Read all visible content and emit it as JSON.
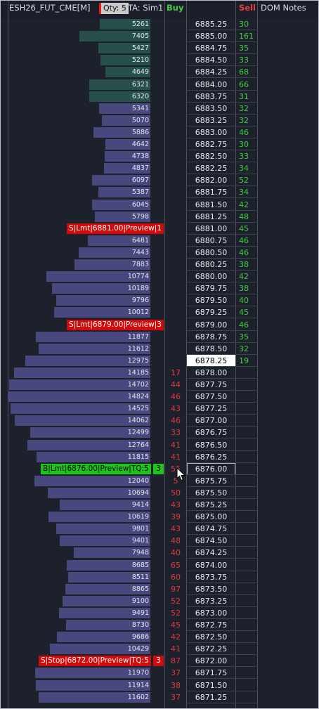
{
  "header": {
    "title": "ESH26_FUT_CME[M]",
    "qty": "Qty: 5",
    "account": "TA: Sim1",
    "buy": "Buy",
    "sell": "Sell",
    "notes": "DOM Notes"
  },
  "colors": {
    "buy_text": "#e03a3a",
    "sell_text": "#3fcf3f",
    "volume_bar": "#48477e",
    "volume_bar_high": "#27504a",
    "order_sell": "#d40a0a",
    "order_buy": "#1cc41c"
  },
  "max_volume": 14824,
  "ladder": [
    {
      "price": "6885.25",
      "volume": "5261",
      "sell": "30",
      "hi": true
    },
    {
      "price": "6885.00",
      "volume": "7405",
      "sell": "161",
      "hi": true
    },
    {
      "price": "6884.75",
      "volume": "5427",
      "sell": "35",
      "hi": true
    },
    {
      "price": "6884.50",
      "volume": "5210",
      "sell": "33",
      "hi": true
    },
    {
      "price": "6884.25",
      "volume": "4649",
      "sell": "68",
      "hi": true
    },
    {
      "price": "6884.00",
      "volume": "6321",
      "sell": "66",
      "hi": true
    },
    {
      "price": "6883.75",
      "volume": "6320",
      "sell": "31",
      "hi": true
    },
    {
      "price": "6883.50",
      "volume": "5341",
      "sell": "32"
    },
    {
      "price": "6883.25",
      "volume": "5070",
      "sell": "32"
    },
    {
      "price": "6883.00",
      "volume": "5886",
      "sell": "46"
    },
    {
      "price": "6882.75",
      "volume": "4642",
      "sell": "30"
    },
    {
      "price": "6882.50",
      "volume": "4738",
      "sell": "33"
    },
    {
      "price": "6882.25",
      "volume": "4837",
      "sell": "34"
    },
    {
      "price": "6882.00",
      "volume": "6097",
      "sell": "52"
    },
    {
      "price": "6881.75",
      "volume": "5387",
      "sell": "34"
    },
    {
      "price": "6881.50",
      "volume": "6045",
      "sell": "42"
    },
    {
      "price": "6881.25",
      "volume": "5798",
      "sell": "48"
    },
    {
      "price": "6881.00",
      "volume": "",
      "sell": "45",
      "order": {
        "label": "S|Lmt|6881.00|Preview|1",
        "color": "red"
      }
    },
    {
      "price": "6880.75",
      "volume": "6481",
      "sell": "46"
    },
    {
      "price": "6880.50",
      "volume": "7443",
      "sell": "46"
    },
    {
      "price": "6880.25",
      "volume": "7883",
      "sell": "38"
    },
    {
      "price": "6880.00",
      "volume": "10774",
      "sell": "42"
    },
    {
      "price": "6879.75",
      "volume": "10189",
      "sell": "38"
    },
    {
      "price": "6879.50",
      "volume": "9796",
      "sell": "40"
    },
    {
      "price": "6879.25",
      "volume": "10012",
      "sell": "45"
    },
    {
      "price": "6879.00",
      "volume": "",
      "sell": "46",
      "order": {
        "label": "S|Lmt|6879.00|Preview|3",
        "color": "red"
      }
    },
    {
      "price": "6878.75",
      "volume": "11877",
      "sell": "35"
    },
    {
      "price": "6878.50",
      "volume": "11612",
      "sell": "32"
    },
    {
      "price": "6878.25",
      "volume": "12975",
      "sell": "19",
      "current": true
    },
    {
      "price": "6878.00",
      "volume": "14185",
      "buy": "17"
    },
    {
      "price": "6877.75",
      "volume": "14702",
      "buy": "44"
    },
    {
      "price": "6877.50",
      "volume": "14824",
      "buy": "46"
    },
    {
      "price": "6877.25",
      "volume": "14525",
      "buy": "43"
    },
    {
      "price": "6877.00",
      "volume": "14062",
      "buy": "46"
    },
    {
      "price": "6876.75",
      "volume": "12499",
      "buy": "33"
    },
    {
      "price": "6876.50",
      "volume": "12764",
      "buy": "41"
    },
    {
      "price": "6876.25",
      "volume": "11815",
      "buy": "41"
    },
    {
      "price": "6876.00",
      "volume": "",
      "buy": "55",
      "selected": true,
      "order": {
        "label": "B|Lmt|6876.00|Preview|TQ:5",
        "color": "green",
        "qty": "3"
      }
    },
    {
      "price": "6875.75",
      "volume": "12040",
      "buy": "5"
    },
    {
      "price": "6875.50",
      "volume": "10694",
      "buy": "50"
    },
    {
      "price": "6875.25",
      "volume": "9414",
      "buy": "43"
    },
    {
      "price": "6875.00",
      "volume": "10619",
      "buy": "39"
    },
    {
      "price": "6874.75",
      "volume": "9801",
      "buy": "43"
    },
    {
      "price": "6874.50",
      "volume": "9401",
      "buy": "48"
    },
    {
      "price": "6874.25",
      "volume": "7948",
      "buy": "40"
    },
    {
      "price": "6874.00",
      "volume": "8685",
      "buy": "65"
    },
    {
      "price": "6873.75",
      "volume": "8511",
      "buy": "60"
    },
    {
      "price": "6873.50",
      "volume": "8865",
      "buy": "97"
    },
    {
      "price": "6873.25",
      "volume": "9100",
      "buy": "52"
    },
    {
      "price": "6873.00",
      "volume": "9491",
      "buy": "52"
    },
    {
      "price": "6872.75",
      "volume": "8730",
      "buy": "45"
    },
    {
      "price": "6872.50",
      "volume": "9686",
      "buy": "42"
    },
    {
      "price": "6872.25",
      "volume": "10429",
      "buy": "41"
    },
    {
      "price": "6872.00",
      "volume": "",
      "buy": "87",
      "order": {
        "label": "S|Stop|6872.00|Preview|TQ:5",
        "color": "red",
        "qty": "3"
      }
    },
    {
      "price": "6871.75",
      "volume": "11970",
      "buy": "37"
    },
    {
      "price": "6871.50",
      "volume": "11914",
      "buy": "38"
    },
    {
      "price": "6871.25",
      "volume": "11602",
      "buy": "37"
    }
  ]
}
